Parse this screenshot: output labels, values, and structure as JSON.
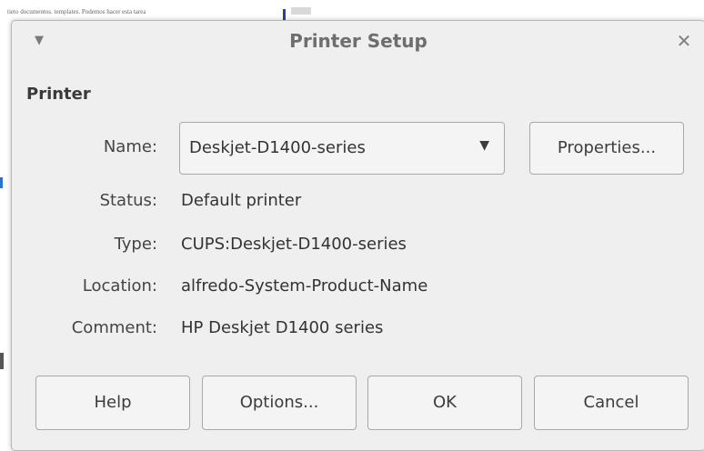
{
  "background": {
    "text": "tieto documentos. templates. Podemos hacer esta tarea"
  },
  "dialog": {
    "title": "Printer Setup",
    "menu_icon": "triangle-down-icon",
    "close_icon": "close-icon",
    "close_glyph": "✕",
    "section_title": "Printer",
    "name_label": "Name:",
    "name_value": "Deskjet-D1400-series",
    "properties_button": "Properties...",
    "status_label": "Status:",
    "status_value": "Default printer",
    "type_label": "Type:",
    "type_value": "CUPS:Deskjet-D1400-series",
    "location_label": "Location:",
    "location_value": "alfredo-System-Product-Name",
    "comment_label": "Comment:",
    "comment_value": "HP Deskjet D1400 series",
    "buttons": {
      "help": "Help",
      "options": "Options...",
      "ok": "OK",
      "cancel": "Cancel"
    }
  }
}
